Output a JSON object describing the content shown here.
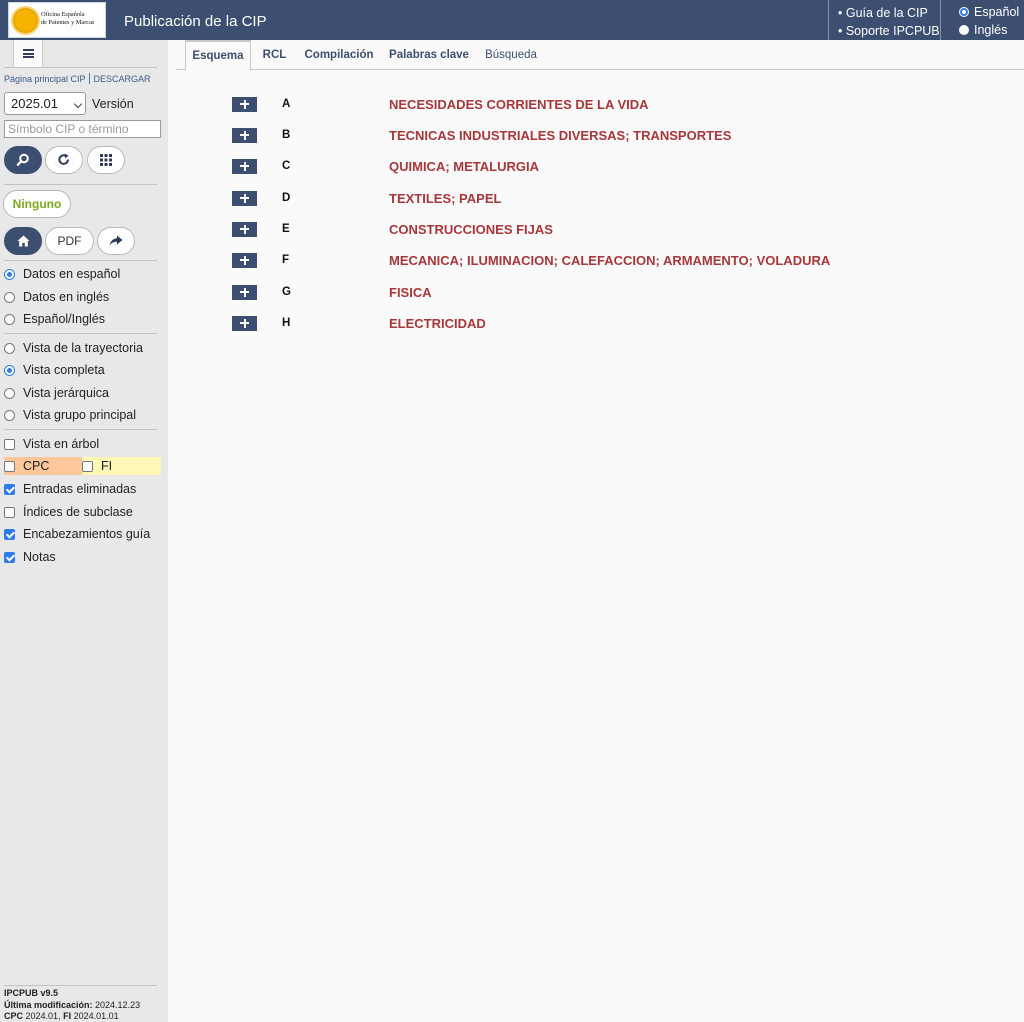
{
  "header": {
    "logo_text_line1": "Oficina Española",
    "logo_text_line2": "de Patentes y Marcas",
    "title": "Publicación de la CIP",
    "links": [
      "• Guía de la CIP",
      "• Soporte IPCPUB"
    ],
    "languages": [
      {
        "label": "Español",
        "selected": true
      },
      {
        "label": "Inglés",
        "selected": false
      }
    ]
  },
  "sidebar": {
    "link_main": "Página principal CIP",
    "link_download": "DESCARGAR",
    "version_value": "2025.01",
    "version_label": "Versión",
    "search_placeholder": "Símbolo CIP o término",
    "ninguno_label": "Ninguno",
    "pdf_label": "PDF",
    "data_options": [
      {
        "label": "Datos en español",
        "selected": true
      },
      {
        "label": "Datos en inglés",
        "selected": false
      },
      {
        "label": "Español/Inglés",
        "selected": false
      }
    ],
    "view_options": [
      {
        "label": "Vista de la trayectoria",
        "selected": false
      },
      {
        "label": "Vista completa",
        "selected": true
      },
      {
        "label": "Vista jerárquica",
        "selected": false
      },
      {
        "label": "Vista grupo principal",
        "selected": false
      }
    ],
    "tree_view": {
      "label": "Vista en árbol",
      "checked": false
    },
    "cpc": {
      "label": "CPC",
      "checked": false
    },
    "fi": {
      "label": "FI",
      "checked": false
    },
    "checks": [
      {
        "label": "Entradas eliminadas",
        "checked": true
      },
      {
        "label": "Índices de subclase",
        "checked": false
      },
      {
        "label": "Encabezamientos guía",
        "checked": true
      },
      {
        "label": "Notas",
        "checked": true
      }
    ],
    "footer": {
      "version_label": "IPCPUB v9.5",
      "last_mod_label": "Última modificación:",
      "last_mod_value": "2024.12.23",
      "cpc_label": "CPC",
      "cpc_value": "2024.01,",
      "fi_label": "FI",
      "fi_value": "2024.01.01"
    }
  },
  "tabs": [
    {
      "label": "Esquema",
      "active": true
    },
    {
      "label": "RCL",
      "active": false
    },
    {
      "label": "Compilación",
      "active": false
    },
    {
      "label": "Palabras clave",
      "active": false
    },
    {
      "label": "Búsqueda",
      "active": false
    }
  ],
  "sections": [
    {
      "code": "A",
      "title": "NECESIDADES CORRIENTES DE LA VIDA"
    },
    {
      "code": "B",
      "title": "TECNICAS INDUSTRIALES DIVERSAS; TRANSPORTES"
    },
    {
      "code": "C",
      "title": "QUIMICA; METALURGIA"
    },
    {
      "code": "D",
      "title": "TEXTILES; PAPEL"
    },
    {
      "code": "E",
      "title": "CONSTRUCCIONES FIJAS"
    },
    {
      "code": "F",
      "title": "MECANICA; ILUMINACION; CALEFACCION; ARMAMENTO; VOLADURA"
    },
    {
      "code": "G",
      "title": "FISICA"
    },
    {
      "code": "H",
      "title": "ELECTRICIDAD"
    }
  ],
  "colors": {
    "header_bg": "#3d4f70",
    "section_title": "#a8373a",
    "ninguno_text": "#7aa81e",
    "cpc_bg": "#ffc79a",
    "fi_bg": "#fff7b6",
    "check_blue": "#2f7be9"
  }
}
